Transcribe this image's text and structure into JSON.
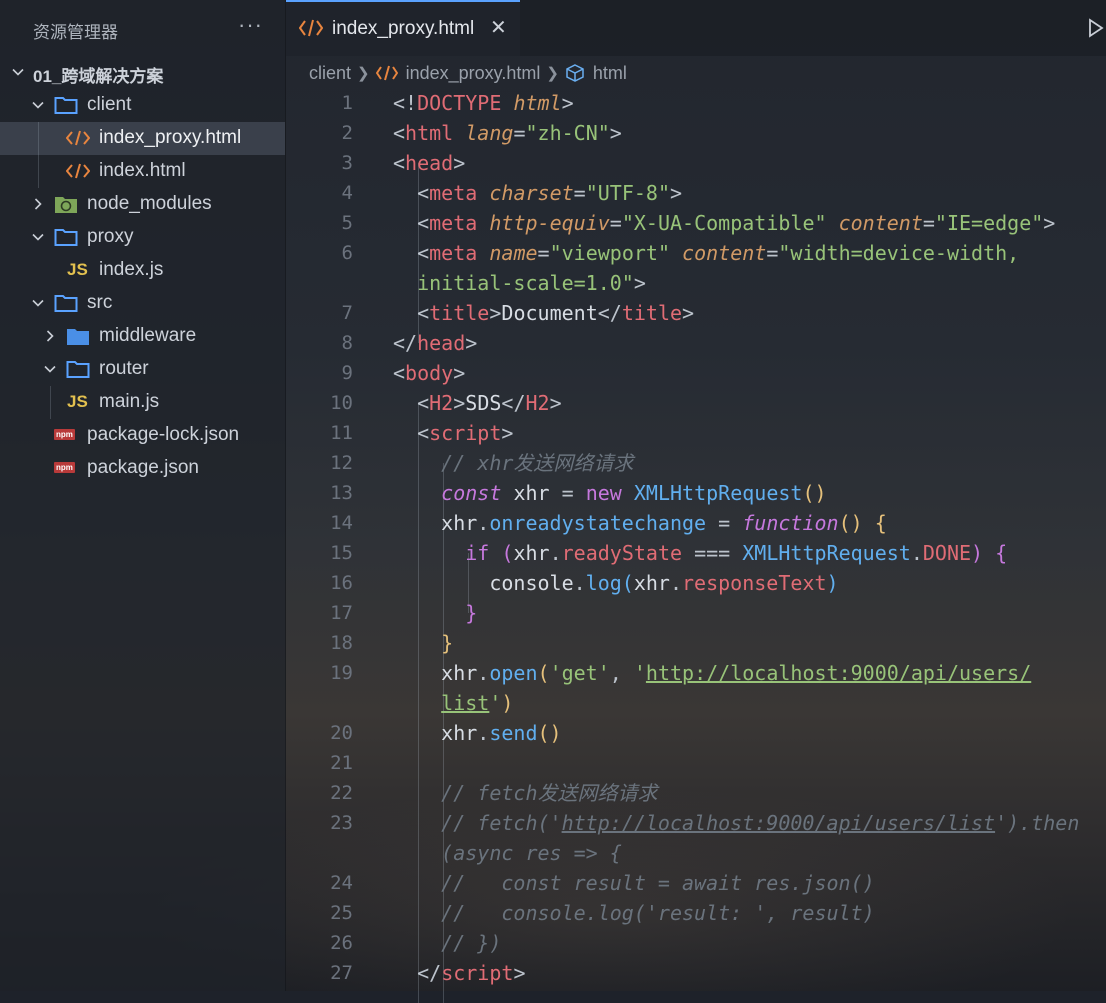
{
  "explorer": {
    "title": "资源管理器",
    "more": "···",
    "root": "01_跨域解决方案",
    "items": [
      {
        "label": "client",
        "icon": "folder"
      },
      {
        "label": "index_proxy.html",
        "icon": "html"
      },
      {
        "label": "index.html",
        "icon": "html"
      },
      {
        "label": "node_modules",
        "icon": "node-folder"
      },
      {
        "label": "proxy",
        "icon": "folder"
      },
      {
        "label": "index.js",
        "icon": "js"
      },
      {
        "label": "src",
        "icon": "folder"
      },
      {
        "label": "middleware",
        "icon": "folder-filled"
      },
      {
        "label": "router",
        "icon": "folder"
      },
      {
        "label": "main.js",
        "icon": "js"
      },
      {
        "label": "package-lock.json",
        "icon": "npm"
      },
      {
        "label": "package.json",
        "icon": "npm"
      }
    ],
    "js_badge": "JS",
    "npm_badge": "npm"
  },
  "tab": {
    "label": "index_proxy.html",
    "close": "✕"
  },
  "breadcrumb": {
    "folder": "client",
    "file": "index_proxy.html",
    "node": "html"
  },
  "editor": {
    "line_numbers": [
      "1",
      "2",
      "3",
      "4",
      "5",
      "6",
      "",
      "7",
      "8",
      "9",
      "10",
      "11",
      "12",
      "13",
      "14",
      "15",
      "16",
      "17",
      "18",
      "19",
      "",
      "20",
      "21",
      "22",
      "23",
      "",
      "24",
      "25",
      "26",
      "27"
    ]
  },
  "colors": {
    "accent": "#5aa2ff",
    "tag": "#e06c75",
    "attribute": "#d19a66",
    "string": "#98c379",
    "keyword": "#c678dd",
    "function": "#61afef",
    "comment": "#6a737d"
  }
}
